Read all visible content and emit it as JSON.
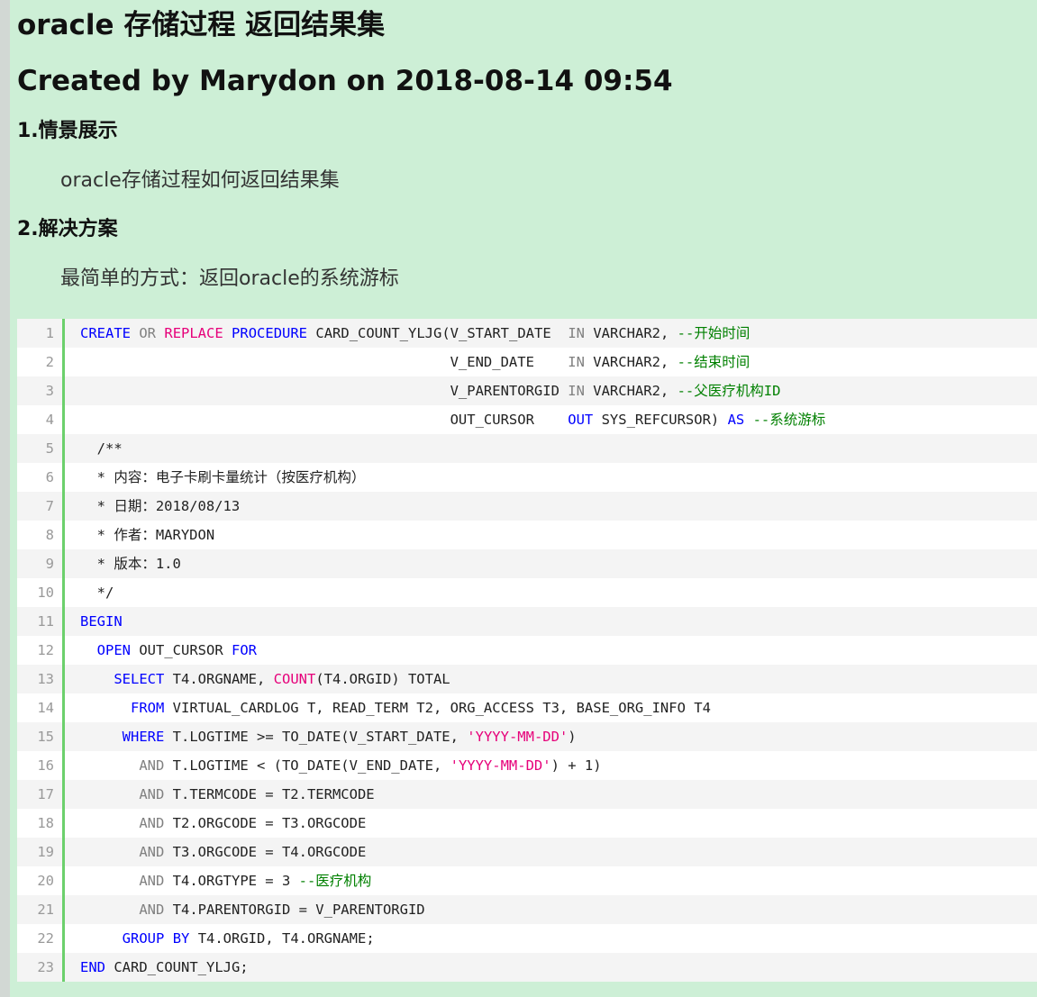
{
  "article": {
    "title": "oracle 存储过程 返回结果集",
    "meta": "Created by Marydon on 2018-08-14 09:54",
    "section1_heading": "1.情景展示",
    "section1_text": "oracle存储过程如何返回结果集",
    "section2_heading": "2.解决方案",
    "section2_text": "最简单的方式：返回oracle的系统游标"
  },
  "colors": {
    "page_background": "#cdefd6",
    "keyword": "#0000ff",
    "operator_keyword": "#808080",
    "function": "#e6007a",
    "string": "#e6007a",
    "comment": "#008000",
    "gutter_bar": "#6cd06c"
  },
  "code": {
    "language": "sql",
    "lines": [
      [
        [
          "k",
          "CREATE"
        ],
        [
          "d",
          " "
        ],
        [
          "g",
          "OR"
        ],
        [
          "d",
          " "
        ],
        [
          "m",
          "REPLACE"
        ],
        [
          "d",
          " "
        ],
        [
          "k",
          "PROCEDURE"
        ],
        [
          "d",
          " CARD_COUNT_YLJG(V_START_DATE  "
        ],
        [
          "g",
          "IN"
        ],
        [
          "d",
          " VARCHAR2, "
        ],
        [
          "c",
          "--开始时间"
        ]
      ],
      [
        [
          "d",
          "                                            V_END_DATE    "
        ],
        [
          "g",
          "IN"
        ],
        [
          "d",
          " VARCHAR2, "
        ],
        [
          "c",
          "--结束时间"
        ]
      ],
      [
        [
          "d",
          "                                            V_PARENTORGID "
        ],
        [
          "g",
          "IN"
        ],
        [
          "d",
          " VARCHAR2, "
        ],
        [
          "c",
          "--父医疗机构ID"
        ]
      ],
      [
        [
          "d",
          "                                            OUT_CURSOR    "
        ],
        [
          "k",
          "OUT"
        ],
        [
          "d",
          " SYS_REFCURSOR) "
        ],
        [
          "k",
          "AS"
        ],
        [
          "d",
          " "
        ],
        [
          "c",
          "--系统游标"
        ]
      ],
      [
        [
          "d",
          "  /**"
        ]
      ],
      [
        [
          "d",
          "  * 内容：电子卡刷卡量统计（按医疗机构）"
        ]
      ],
      [
        [
          "d",
          "  * 日期：2018/08/13"
        ]
      ],
      [
        [
          "d",
          "  * 作者：MARYDON"
        ]
      ],
      [
        [
          "d",
          "  * 版本：1.0"
        ]
      ],
      [
        [
          "d",
          "  */"
        ]
      ],
      [
        [
          "k",
          "BEGIN"
        ]
      ],
      [
        [
          "d",
          "  "
        ],
        [
          "k",
          "OPEN"
        ],
        [
          "d",
          " OUT_CURSOR "
        ],
        [
          "k",
          "FOR"
        ]
      ],
      [
        [
          "d",
          "    "
        ],
        [
          "k",
          "SELECT"
        ],
        [
          "d",
          " T4.ORGNAME, "
        ],
        [
          "m",
          "COUNT"
        ],
        [
          "d",
          "(T4.ORGID) TOTAL"
        ]
      ],
      [
        [
          "d",
          "      "
        ],
        [
          "k",
          "FROM"
        ],
        [
          "d",
          " VIRTUAL_CARDLOG T, READ_TERM T2, ORG_ACCESS T3, BASE_ORG_INFO T4"
        ]
      ],
      [
        [
          "d",
          "     "
        ],
        [
          "k",
          "WHERE"
        ],
        [
          "d",
          " T.LOGTIME >= TO_DATE(V_START_DATE, "
        ],
        [
          "s",
          "'YYYY-MM-DD'"
        ],
        [
          "d",
          ")"
        ]
      ],
      [
        [
          "d",
          "       "
        ],
        [
          "g",
          "AND"
        ],
        [
          "d",
          " T.LOGTIME < (TO_DATE(V_END_DATE, "
        ],
        [
          "s",
          "'YYYY-MM-DD'"
        ],
        [
          "d",
          ") + 1)"
        ]
      ],
      [
        [
          "d",
          "       "
        ],
        [
          "g",
          "AND"
        ],
        [
          "d",
          " T.TERMCODE = T2.TERMCODE"
        ]
      ],
      [
        [
          "d",
          "       "
        ],
        [
          "g",
          "AND"
        ],
        [
          "d",
          " T2.ORGCODE = T3.ORGCODE"
        ]
      ],
      [
        [
          "d",
          "       "
        ],
        [
          "g",
          "AND"
        ],
        [
          "d",
          " T3.ORGCODE = T4.ORGCODE"
        ]
      ],
      [
        [
          "d",
          "       "
        ],
        [
          "g",
          "AND"
        ],
        [
          "d",
          " T4.ORGTYPE = 3 "
        ],
        [
          "c",
          "--医疗机构"
        ]
      ],
      [
        [
          "d",
          "       "
        ],
        [
          "g",
          "AND"
        ],
        [
          "d",
          " T4.PARENTORGID = V_PARENTORGID"
        ]
      ],
      [
        [
          "d",
          "     "
        ],
        [
          "k",
          "GROUP"
        ],
        [
          "d",
          " "
        ],
        [
          "k",
          "BY"
        ],
        [
          "d",
          " T4.ORGID, T4.ORGNAME;"
        ]
      ],
      [
        [
          "k",
          "END"
        ],
        [
          "d",
          " CARD_COUNT_YLJG;"
        ]
      ]
    ]
  }
}
